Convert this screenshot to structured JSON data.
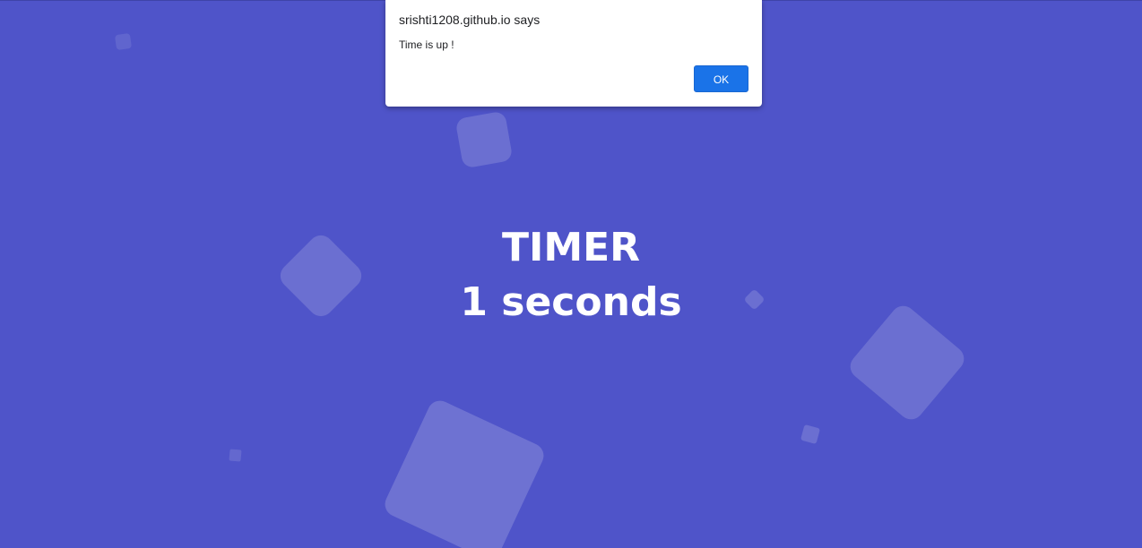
{
  "timer": {
    "title": "TIMER",
    "value": "1 seconds"
  },
  "dialog": {
    "origin": "srishti1208.github.io says",
    "message": "Time is up !",
    "ok_label": "OK"
  },
  "colors": {
    "background": "#4f54c9",
    "button": "#1a73e8"
  }
}
